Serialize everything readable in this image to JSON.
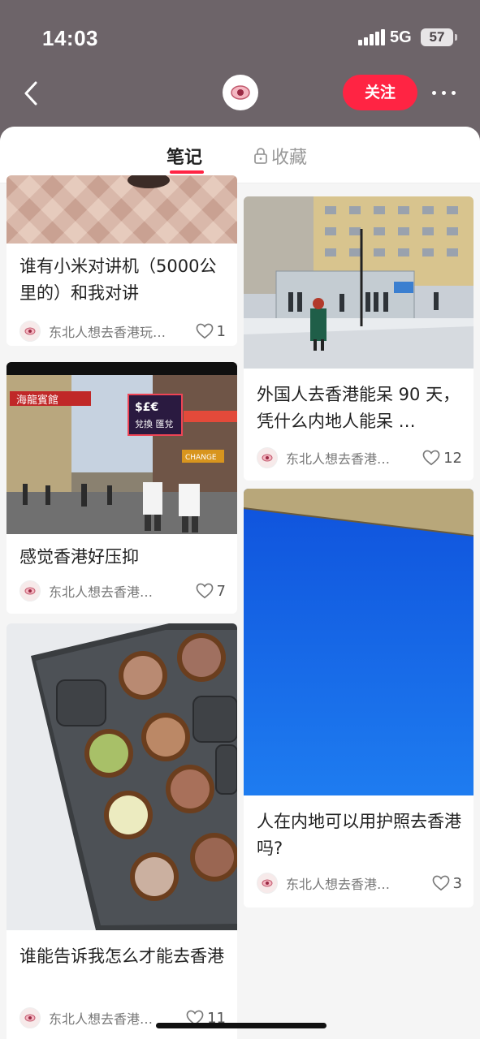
{
  "status": {
    "time": "14:03",
    "network": "5G",
    "battery": "57"
  },
  "nav": {
    "follow_label": "关注"
  },
  "tabs": [
    {
      "label": "笔记"
    },
    {
      "label": "收藏"
    }
  ],
  "notes": [
    {
      "title": "谁有小米对讲机（5000公里的）和我对讲",
      "author": "东北人想去香港玩…",
      "likes": "1"
    },
    {
      "title": "外国人去香港能呆 90 天，凭什么内地人能呆 …",
      "author": "东北人想去香港…",
      "likes": "12"
    },
    {
      "title": "感觉香港好压抑",
      "author": "东北人想去香港…",
      "likes": "7"
    },
    {
      "title": "人在内地可以用护照去香港吗?",
      "author": "东北人想去香港…",
      "likes": "3"
    },
    {
      "title": "谁能告诉我怎么才能去香港",
      "author": "东北人想去香港…",
      "likes": "11"
    }
  ],
  "street_signs": [
    "海龍賓館",
    "兌換 匯兌",
    "CHANGE",
    "$£€"
  ],
  "colors": {
    "accent": "#ff2443",
    "header_bg": "#6d6469",
    "sky": "#1560e6"
  }
}
